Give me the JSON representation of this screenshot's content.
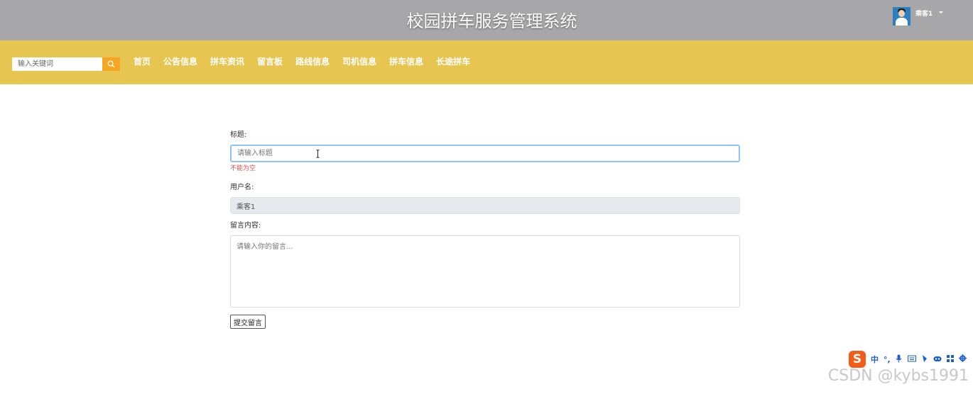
{
  "header": {
    "title": "校园拼车服务管理系统",
    "user_name": "乘客1"
  },
  "nav": {
    "search_placeholder": "输入关键词",
    "items": [
      "首页",
      "公告信息",
      "拼车资讯",
      "留言板",
      "路线信息",
      "司机信息",
      "拼车信息",
      "长途拼车"
    ]
  },
  "form": {
    "title_label": "标题:",
    "title_placeholder": "请输入标题",
    "title_error": "不能为空",
    "username_label": "用户名:",
    "username_value": "乘客1",
    "content_label": "留言内容:",
    "content_placeholder": "请输入你的留言...",
    "submit_label": "提交留言"
  },
  "tray": {
    "logo": "S",
    "lang": "中",
    "icons": [
      "punctuation-icon",
      "microphone-icon",
      "keyboard-icon",
      "skin-icon",
      "game-icon",
      "apps-icon",
      "settings-icon"
    ]
  },
  "watermark": "CSDN @kybs1991",
  "colors": {
    "topbar": "#a7a7aa",
    "navbar": "#e6c550",
    "search_button": "#f5a623",
    "error": "#d9534f",
    "focus_border": "#90c3f5"
  }
}
